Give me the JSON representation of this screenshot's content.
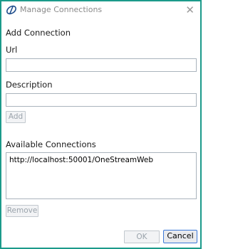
{
  "window": {
    "title": "Manage Connections",
    "close_glyph": "✕",
    "app_icon": "onestream-logo-icon"
  },
  "add_section": {
    "heading": "Add Connection",
    "url_label": "Url",
    "url_value": "",
    "description_label": "Description",
    "description_value": "",
    "add_button": "Add"
  },
  "available_section": {
    "heading": "Available Connections",
    "items": [
      "http://localhost:50001/OneStreamWeb"
    ],
    "remove_button": "Remove"
  },
  "footer": {
    "ok_button": "OK",
    "cancel_button": "Cancel"
  },
  "colors": {
    "border_accent": "#1b9a8a",
    "focus_blue": "#3c78d8"
  }
}
